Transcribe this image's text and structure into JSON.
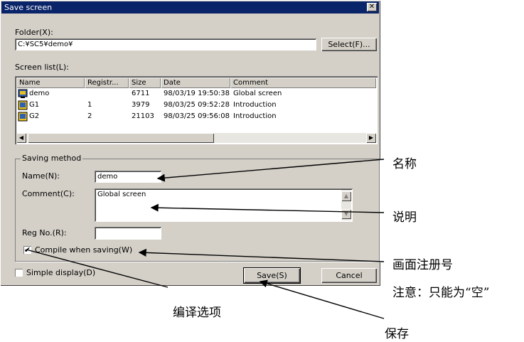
{
  "window": {
    "title": "Save screen",
    "close_glyph": "✕"
  },
  "folder": {
    "label": "Folder(X):",
    "value": "C:¥SC5¥demo¥",
    "select_button": "Select(F)..."
  },
  "screen_list": {
    "label": "Screen list(L):",
    "columns": [
      "Name",
      "Registr...",
      "Size",
      "Date",
      "Comment"
    ],
    "rows": [
      {
        "icon": "screen-global-icon",
        "name": "demo",
        "reg": "",
        "size": "6711",
        "date": "98/03/19 19:50:38",
        "comment": "Global screen"
      },
      {
        "icon": "screen-page-icon",
        "name": "G1",
        "reg": "1",
        "size": "3979",
        "date": "98/03/25 09:52:28",
        "comment": "Introduction"
      },
      {
        "icon": "screen-page-icon",
        "name": "G2",
        "reg": "2",
        "size": "21103",
        "date": "98/03/25 09:56:08",
        "comment": "Introduction"
      }
    ],
    "scroll_left": "◀",
    "scroll_right": "▶"
  },
  "saving_method": {
    "label": "Saving method",
    "name_label": "Name(N):",
    "name_value": "demo",
    "comment_label": "Comment(C):",
    "comment_value": "Global screen",
    "reg_label": "Reg No.(R):",
    "reg_value": "",
    "compile_label": "Compile when saving(W)",
    "compile_checked": "✔"
  },
  "simple_display": {
    "label": "Simple display(D)"
  },
  "buttons": {
    "save": "Save(S)",
    "cancel": "Cancel"
  },
  "annotations": {
    "name": "名称",
    "comment": "说明",
    "reg_no": "画面注册号",
    "note": "注意：只能为“空”",
    "compile": "编译选项",
    "save": "保存"
  },
  "colors": {
    "titlebar": "#0a246a",
    "dialog_bg": "#d4d0c8",
    "icon_blue": "#3060b0",
    "icon_yellow": "#e8c020"
  }
}
